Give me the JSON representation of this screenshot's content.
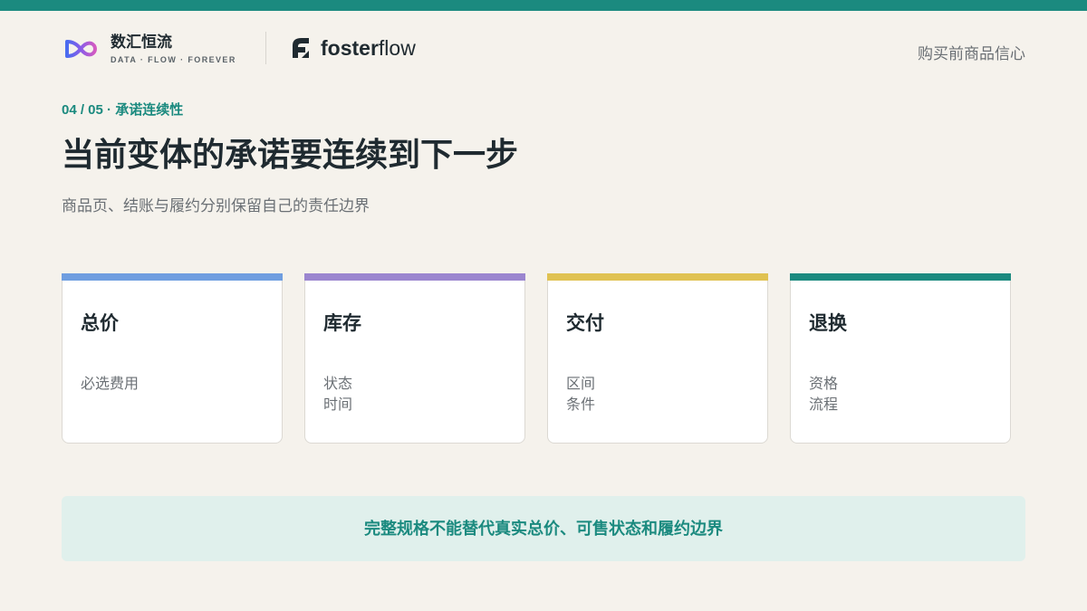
{
  "brand": {
    "name": "数汇恒流",
    "tagline": "DATA · FLOW · FOREVER",
    "logo_icon": "infinity-loop-icon"
  },
  "partner": {
    "name_bold": "foster",
    "name_regular": "flow",
    "logo_icon": "leaf-f-icon"
  },
  "header": {
    "right_text": "购买前商品信心"
  },
  "slide": {
    "eyebrow": "04 / 05 · 承诺连续性",
    "title": "当前变体的承诺要连续到下一步",
    "subtitle": "商品页、结账与履约分别保留自己的责任边界"
  },
  "cards": [
    {
      "title": "总价",
      "lines": [
        "必选费用"
      ],
      "accent": "#6f9ee0"
    },
    {
      "title": "库存",
      "lines": [
        "状态",
        "时间"
      ],
      "accent": "#9b86cf"
    },
    {
      "title": "交付",
      "lines": [
        "区间",
        "条件"
      ],
      "accent": "#e0c252"
    },
    {
      "title": "退换",
      "lines": [
        "资格",
        "流程"
      ],
      "accent": "#1b8a7f"
    }
  ],
  "callout": {
    "text": "完整规格不能替代真实总价、可售状态和履约边界"
  },
  "colors": {
    "accent": "#1b8a7f",
    "background": "#f5f2ec",
    "callout_bg": "#e0f0ec"
  }
}
